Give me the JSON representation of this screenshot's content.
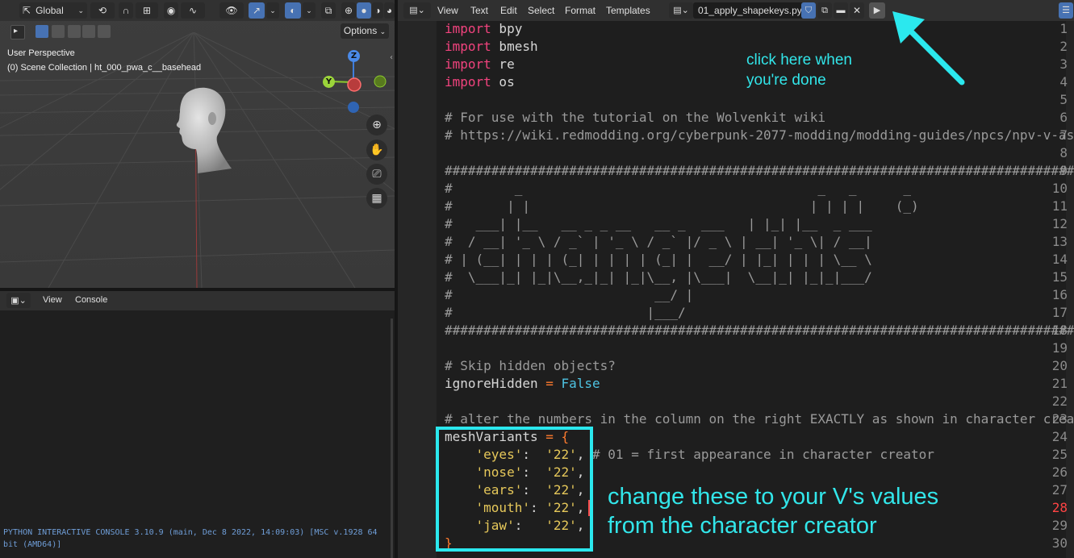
{
  "viewport": {
    "transform_orientation": "Global",
    "options_label": "Options",
    "view_name": "User Perspective",
    "collection_path": "(0) Scene Collection | ht_000_pwa_c__basehead",
    "gizmo_axes": [
      "Z",
      "Y"
    ]
  },
  "console": {
    "menu": [
      "View",
      "Console"
    ],
    "output": "PYTHON INTERACTIVE CONSOLE 3.10.9 (main, Dec  8 2022, 14:09:03) [MSC v.1928 64 bit (AMD64)]"
  },
  "editor": {
    "menu": [
      "View",
      "Text",
      "Edit",
      "Select",
      "Format",
      "Templates"
    ],
    "filename": "01_apply_shapekeys.py",
    "current_line": 28,
    "lines": [
      {
        "n": "1",
        "t": "import bpy"
      },
      {
        "n": "2",
        "t": "import bmesh"
      },
      {
        "n": "3",
        "t": "import re"
      },
      {
        "n": "4",
        "t": "import os"
      },
      {
        "n": "5",
        "t": ""
      },
      {
        "n": "6",
        "t": "# For use with the tutorial on the Wolvenkit wiki"
      },
      {
        "n": "7",
        "t": "# https://wiki.redmodding.org/cyberpunk-2077-modding/modding-guides/npcs/npv-v-as-custom-npc"
      },
      {
        "n": "8",
        "t": ""
      },
      {
        "n": "9",
        "t": "#######################################################################################"
      },
      {
        "n": "10",
        "t": "#        _                                      _   _      _"
      },
      {
        "n": "11",
        "t": "#       | |                                    | | | |    (_)"
      },
      {
        "n": "12",
        "t": "#   ___| |__   __ _ _ __   __ _  ___   | |_| |__  _ ___"
      },
      {
        "n": "13",
        "t": "#  / __| '_ \\ / _` | '_ \\ / _` |/ _ \\ | __| '_ \\| / __|"
      },
      {
        "n": "14",
        "t": "# | (__| | | | (_| | | | | (_| |  __/ | |_| | | | \\__ \\"
      },
      {
        "n": "15",
        "t": "#  \\___|_| |_|\\__,_|_| |_|\\__, |\\___|  \\__|_| |_|_|___/"
      },
      {
        "n": "16",
        "t": "#                          __/ |"
      },
      {
        "n": "17",
        "t": "#                         |___/"
      },
      {
        "n": "18",
        "t": "#######################################################################################"
      },
      {
        "n": "19",
        "t": ""
      },
      {
        "n": "20",
        "t": "# Skip hidden objects?"
      },
      {
        "n": "21",
        "t": "ignoreHidden = False"
      },
      {
        "n": "22",
        "t": ""
      },
      {
        "n": "23",
        "t": "# alter the numbers in the column on the right EXACTLY as shown in character creator"
      },
      {
        "n": "24",
        "t": "meshVariants = {"
      },
      {
        "n": "25",
        "t": "    'eyes':  '22', # 01 = first appearance in character creator"
      },
      {
        "n": "26",
        "t": "    'nose':  '22',"
      },
      {
        "n": "27",
        "t": "    'ears':  '22',"
      },
      {
        "n": "28",
        "t": "    'mouth': '22',"
      },
      {
        "n": "29",
        "t": "    'jaw':   '22',"
      },
      {
        "n": "30",
        "t": "}"
      }
    ]
  },
  "annotations": {
    "run_hint_line1": "click here when",
    "run_hint_line2": "you're done",
    "values_hint_line1": "change these to your V's values",
    "values_hint_line2": "from the character creator"
  },
  "colors": {
    "annotation": "#2be8ee",
    "keyword": "#f2437e",
    "string": "#e6c85a",
    "operator": "#ff7b2e",
    "boolean": "#4ec3e2",
    "comment": "#9a9a9a"
  }
}
